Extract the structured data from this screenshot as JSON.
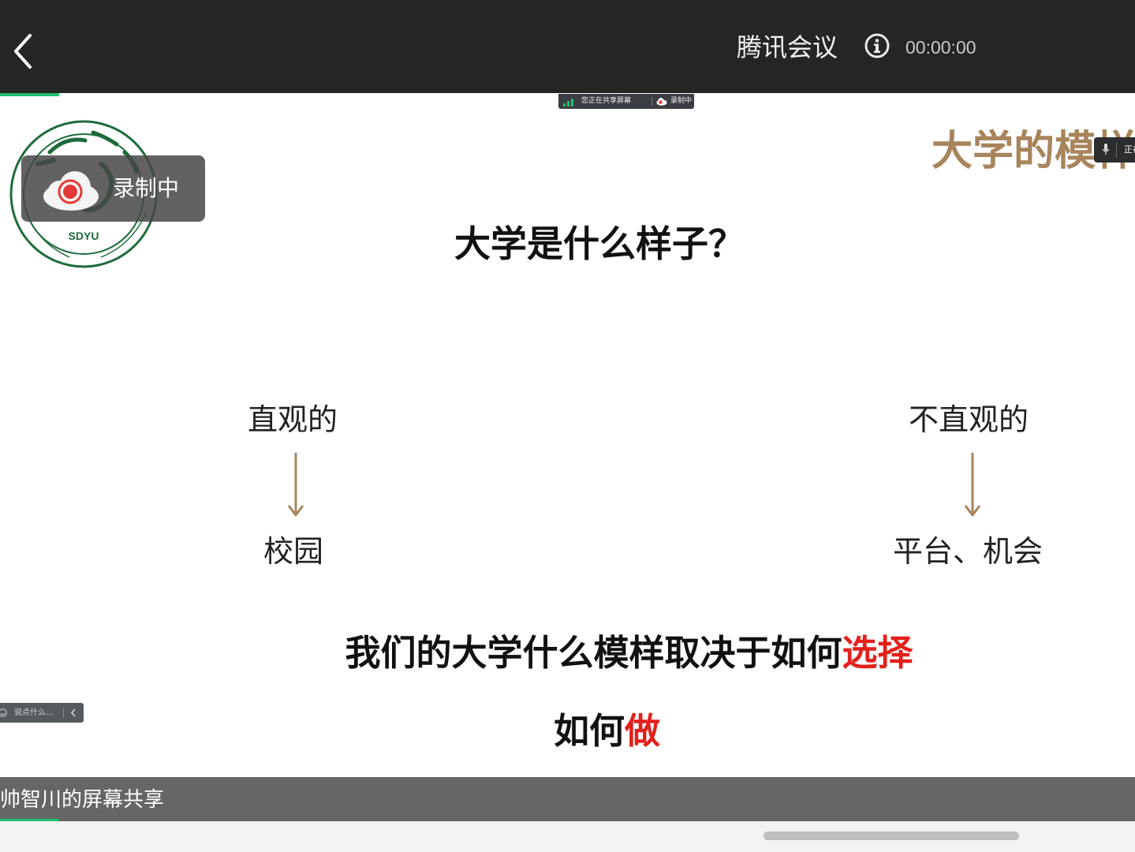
{
  "header": {
    "app_title": "腾讯会议",
    "timer": "00:00:00"
  },
  "share_status": {
    "sharing_text": "您正在共享屏幕",
    "recording_text": "录制中"
  },
  "recording_badge": {
    "label": "录制中"
  },
  "logo": {
    "text": "SDYU",
    "arc_text": "SCHOOL OF INFORMATION ENGINEERING"
  },
  "slide": {
    "title_partial": "大学的模样",
    "question": "大学是什么样子？",
    "left": {
      "heading": "直观的",
      "result": "校园"
    },
    "right": {
      "heading": "不直观的",
      "result": "平台、机会"
    },
    "conclusion_main": "我们的大学什么模样取决于如何",
    "conclusion_highlight": "选择",
    "how_main": "如何",
    "how_highlight": "做",
    "arrow_color": "#a8845c",
    "title_color": "#a8845c",
    "highlight_color": "#e3201b"
  },
  "mini_chip": {
    "text": "正在"
  },
  "chat": {
    "placeholder": "说点什么..."
  },
  "share_bar": {
    "presenter_label": "帅智川的屏幕共享"
  },
  "colors": {
    "topbar": "#232527",
    "accent_green": "#1fbf6f",
    "recording_red": "#e53935"
  }
}
